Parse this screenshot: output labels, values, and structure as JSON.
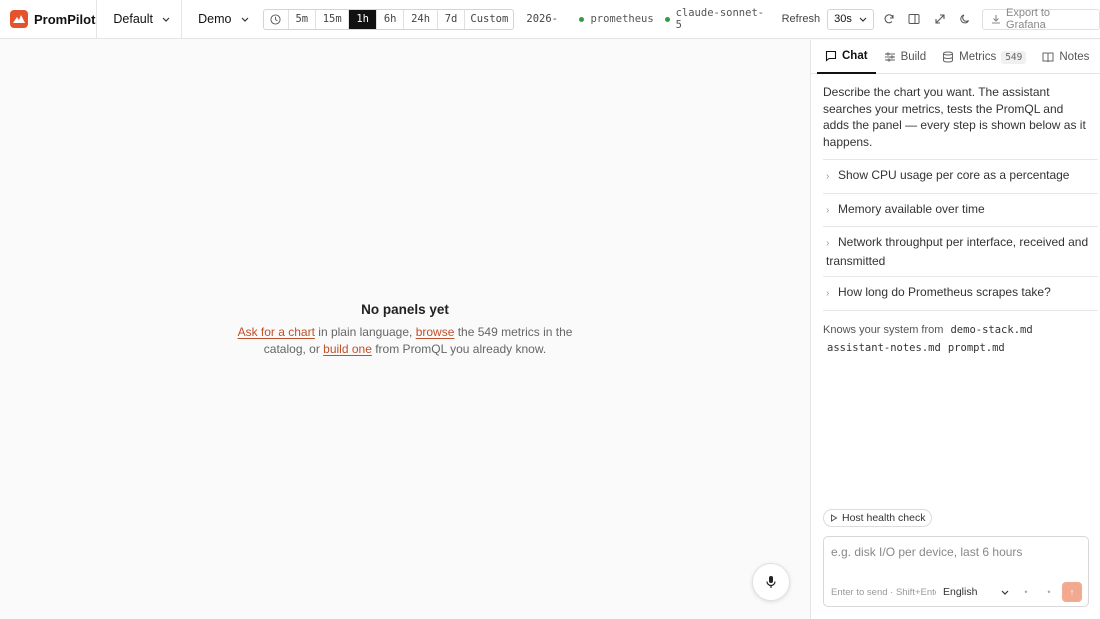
{
  "app": {
    "name": "PromPilot",
    "brand_color": "#e5532d",
    "logo_icon": "mountain-logo-icon"
  },
  "topbar": {
    "dashboard_select": "Default",
    "datasource_select": "Demo",
    "time_ranges": [
      "5m",
      "15m",
      "1h",
      "6h",
      "24h",
      "7d",
      "Custom"
    ],
    "active_range": "1h",
    "date_text": "2026-",
    "status": [
      {
        "label": "prometheus",
        "color": "#2f9e44"
      },
      {
        "label": "claude-sonnet-5",
        "color": "#2f9e44"
      }
    ],
    "refresh_label": "Refresh",
    "refresh_interval": "30s",
    "export_label": "Export to Grafana"
  },
  "main": {
    "empty_title": "No panels yet",
    "link_ask": "Ask for a chart",
    "text_1": " in plain language, ",
    "link_browse": "browse",
    "text_2": " the 549 metrics in the catalog, or ",
    "link_build": "build one",
    "text_3": " from PromQL you already know."
  },
  "panel": {
    "tabs": [
      {
        "label": "Chat",
        "icon": "chat-icon"
      },
      {
        "label": "Build",
        "icon": "build-icon"
      },
      {
        "label": "Metrics",
        "icon": "metrics-icon",
        "badge": "549"
      },
      {
        "label": "Notes",
        "icon": "notes-icon"
      }
    ],
    "intro": "Describe the chart you want. The assistant searches your metrics, tests the PromQL and adds the panel — every step is shown below as it happens.",
    "suggestions": [
      "Show CPU usage per core as a percentage",
      "Memory available over time",
      "Network throughput per interface, received and transmitted",
      "How long do Prometheus scrapes take?"
    ],
    "knows_prefix": "Knows your system from",
    "knows_files": [
      "demo-stack.md",
      "assistant-notes.md",
      "prompt.md"
    ],
    "chip_label": "Host health check",
    "input_placeholder": "e.g. disk I/O per device, last 6 hours",
    "send_hint": "Enter to send · Shift+Enter for newline",
    "language": "English",
    "accent_color": "#f3a98f"
  }
}
